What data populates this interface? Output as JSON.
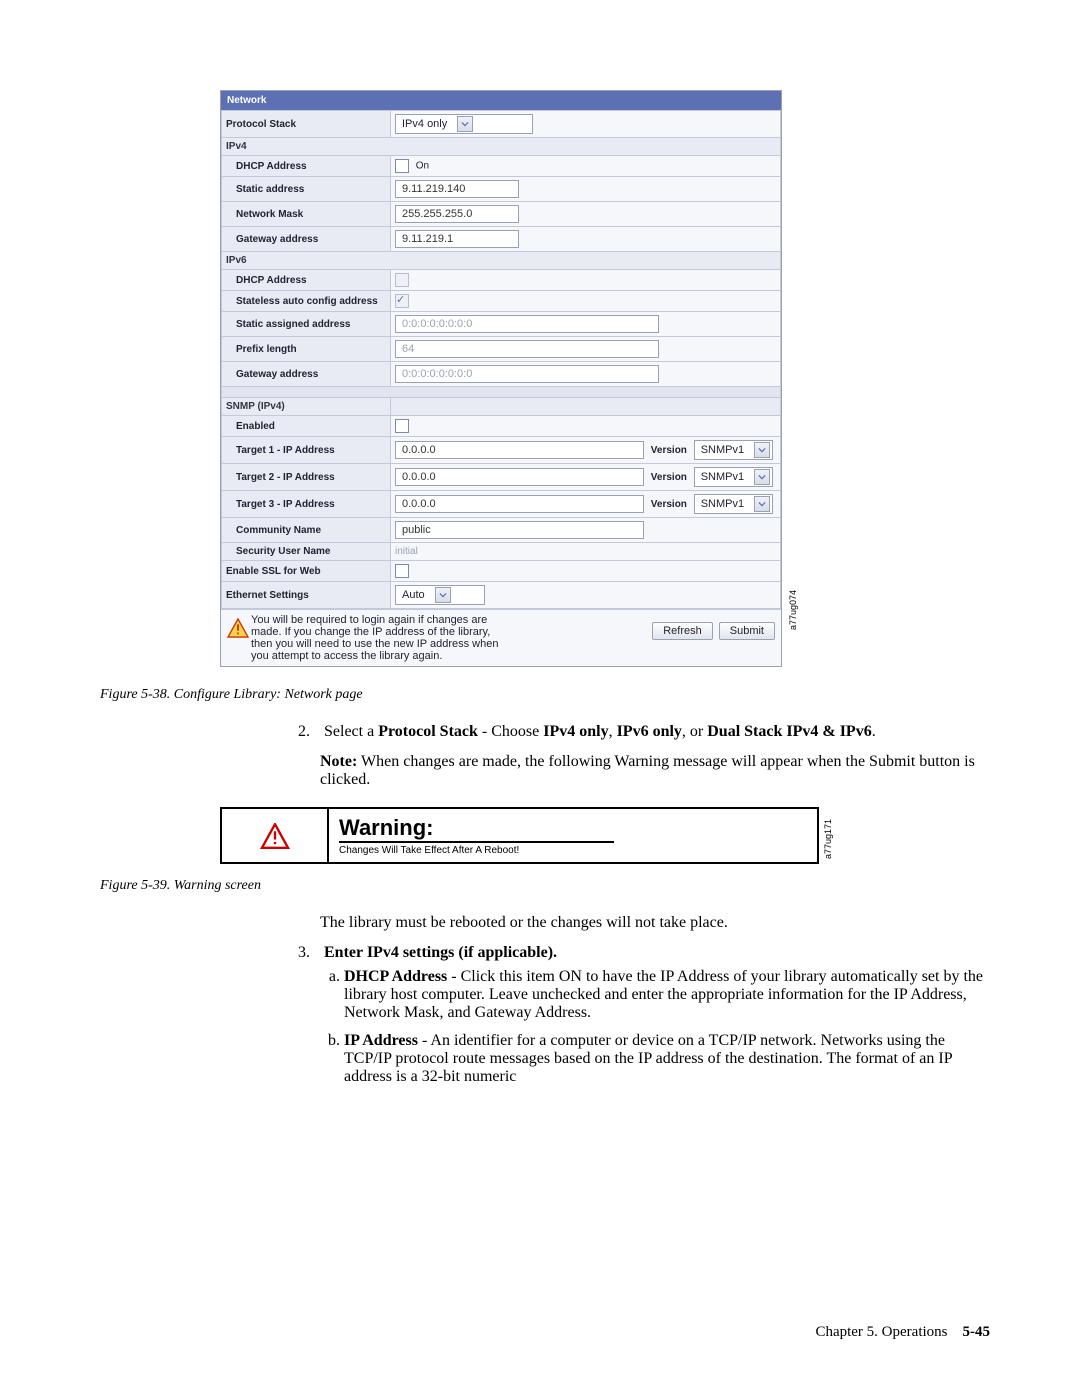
{
  "network": {
    "header": "Network",
    "protocol_stack": {
      "label": "Protocol Stack",
      "value": "IPv4 only"
    },
    "ipv4": {
      "section": "IPv4",
      "dhcp_label": "DHCP Address",
      "dhcp_text": "On",
      "static_label": "Static address",
      "static_value": "9.11.219.140",
      "mask_label": "Network Mask",
      "mask_value": "255.255.255.0",
      "gw_label": "Gateway address",
      "gw_value": "9.11.219.1"
    },
    "ipv6": {
      "section": "IPv6",
      "dhcp_label": "DHCP Address",
      "stateless_label": "Stateless auto config address",
      "static_label": "Static assigned address",
      "static_value": "0:0:0:0:0:0:0:0",
      "prefix_label": "Prefix length",
      "prefix_value": "64",
      "gw_label": "Gateway address",
      "gw_value": "0:0:0:0:0:0:0:0"
    },
    "snmp": {
      "section": "SNMP (IPv4)",
      "enabled_label": "Enabled",
      "targets": [
        {
          "label": "Target 1 - IP Address",
          "ip": "0.0.0.0",
          "vlabel": "Version",
          "version": "SNMPv1"
        },
        {
          "label": "Target 2 - IP Address",
          "ip": "0.0.0.0",
          "vlabel": "Version",
          "version": "SNMPv1"
        },
        {
          "label": "Target 3 - IP Address",
          "ip": "0.0.0.0",
          "vlabel": "Version",
          "version": "SNMPv1"
        }
      ],
      "community_label": "Community Name",
      "community_value": "public",
      "secuser_label": "Security User Name",
      "secuser_value": "initial",
      "ssl_label": "Enable SSL for Web",
      "eth_label": "Ethernet Settings",
      "eth_value": "Auto"
    },
    "footer_text": "You will be required to login again if changes are made. If you change the IP address of the library, then you will need to use the new IP address when you attempt to access the library again.",
    "refresh": "Refresh",
    "submit": "Submit",
    "side_label": "a77ug074"
  },
  "fig38_caption": "Figure 5-38. Configure Library: Network page",
  "step2": {
    "num": "2.",
    "text_a": "Select a ",
    "b1": "Protocol Stack",
    "text_b": " - Choose ",
    "b2": "IPv4 only",
    "sep1": ", ",
    "b3": "IPv6 only",
    "sep2": ", or ",
    "b4": "Dual Stack IPv4 & IPv6",
    "tail": "."
  },
  "note": {
    "label": "Note:",
    "text": " When changes are made, the following Warning message will appear when the Submit button is clicked."
  },
  "warning_fig": {
    "title": "Warning:",
    "sub": "Changes Will Take Effect After A Reboot!",
    "side_label": "a77ug171"
  },
  "fig39_caption": "Figure 5-39. Warning screen",
  "after_warning": "The library must be rebooted or the changes will not take place.",
  "step3": {
    "num": "3.",
    "title": "Enter IPv4 settings (if applicable).",
    "a_label": "DHCP Address",
    "a_text": " - Click this item ON to have the IP Address of your library automatically set by the library host computer. Leave unchecked and enter the appropriate information for the IP Address, Network Mask, and Gateway Address.",
    "b_label": "IP Address",
    "b_text": " - An identifier for a computer or device on a TCP/IP network. Networks using the TCP/IP protocol route messages based on the IP address of the destination. The format of an IP address is a 32-bit numeric"
  },
  "footer": {
    "chapter": "Chapter 5. Operations",
    "page": "5-45"
  }
}
